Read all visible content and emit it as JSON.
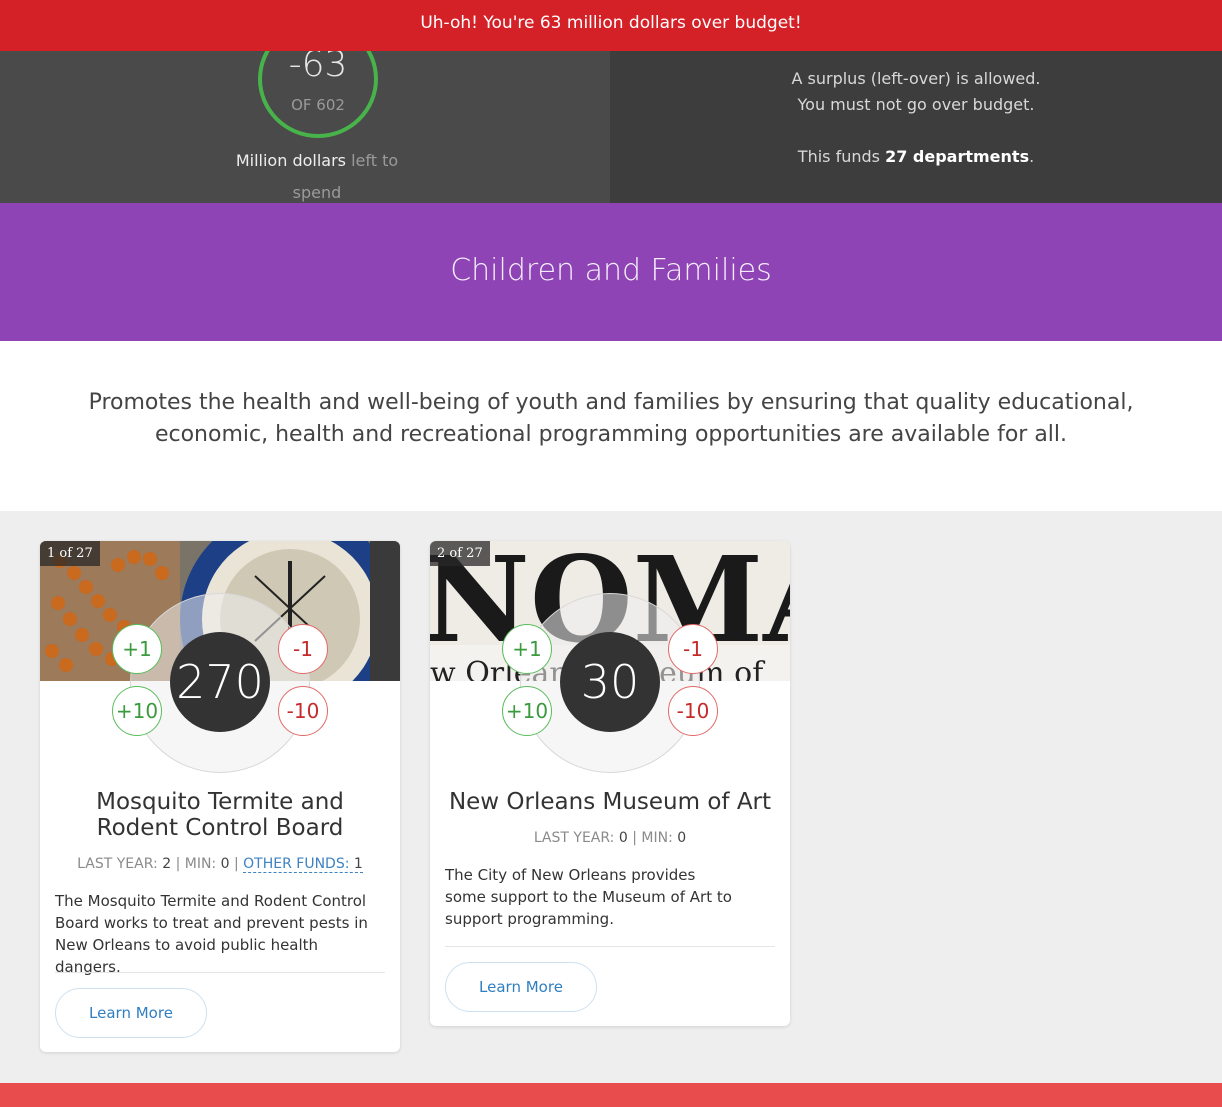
{
  "alert": {
    "message": "Uh-oh! You're 63 million dollars over budget!"
  },
  "budget": {
    "remaining": "-63",
    "of_label": "OF 602",
    "caption_bold": "Million dollars",
    "caption_rest": "left to spend",
    "rules_line1": "A surplus (left-over) is allowed.",
    "rules_line2": "You must not go over budget.",
    "funds_prefix": "This funds",
    "funds_count": "27 departments",
    "funds_suffix": "."
  },
  "category": {
    "title": "Children and Families",
    "description": "Promotes the health and well-being of youth and families by ensuring that quality educational, economic, health and recreational programming opportunities are available for all."
  },
  "cards": [
    {
      "badge": "1 of 27",
      "amount": "270",
      "plus1": "+1",
      "minus1": "-1",
      "plus10": "+10",
      "minus10": "-10",
      "title": "Mosquito Termite and Rodent Control Board",
      "last_year_label": "LAST YEAR:",
      "last_year": "2",
      "min_label": "MIN:",
      "min": "0",
      "other_funds_label": "OTHER FUNDS:",
      "other_funds": "1",
      "description": "The Mosquito Termite and Rodent Control Board works to treat and prevent pests in New Orleans to avoid public health dangers.",
      "learn_more": "Learn More"
    },
    {
      "badge": "2 of 27",
      "amount": "30",
      "plus1": "+1",
      "minus1": "-1",
      "plus10": "+10",
      "minus10": "-10",
      "title": "New Orleans Museum of Art",
      "last_year_label": "LAST YEAR:",
      "last_year": "0",
      "min_label": "MIN:",
      "min": "0",
      "description": "The City of New Orleans provides some support to the Museum of Art to support programming.",
      "learn_more": "Learn More"
    }
  ],
  "colors": {
    "alert": "#d42027",
    "category": "#8e44b4",
    "gauge_ring": "#47b34a",
    "plus": "#3a9a3d",
    "minus": "#c72a2a",
    "link": "#2f7fc1"
  }
}
